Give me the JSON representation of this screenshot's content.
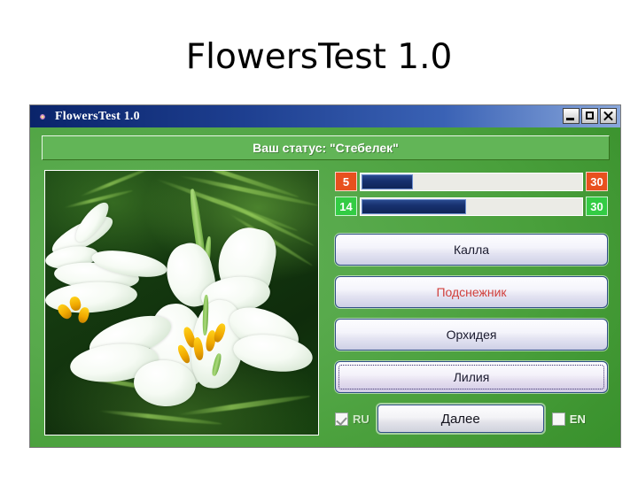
{
  "slide": {
    "title": "FlowersTest 1.0"
  },
  "window": {
    "titlebar": {
      "icon": "flower-icon",
      "title": "FlowersTest 1.0",
      "minimize_label": "minimize-icon",
      "maximize_label": "maximize-icon",
      "close_label": "close-icon"
    },
    "status": {
      "text": "Ваш статус: \"Стебелек\""
    },
    "picture": {
      "alt": "white lily flowers on dark green fern background"
    },
    "progress_bars": [
      {
        "name": "score-bar",
        "value": 5,
        "max": 30,
        "value_label": "5",
        "max_label": "30",
        "color": "#e8501e",
        "percent": 23
      },
      {
        "name": "question-bar",
        "value": 14,
        "max": 30,
        "value_label": "14",
        "max_label": "30",
        "color": "#33cc44",
        "percent": 47
      }
    ],
    "answers": [
      {
        "label": "Калла",
        "state": "normal"
      },
      {
        "label": "Подснежник",
        "state": "wrong"
      },
      {
        "label": "Орхидея",
        "state": "normal"
      },
      {
        "label": "Лилия",
        "state": "focused"
      }
    ],
    "bottom": {
      "ru_label": "RU",
      "ru_checked": true,
      "en_label": "EN",
      "en_checked": false,
      "next_label": "Далее"
    }
  }
}
